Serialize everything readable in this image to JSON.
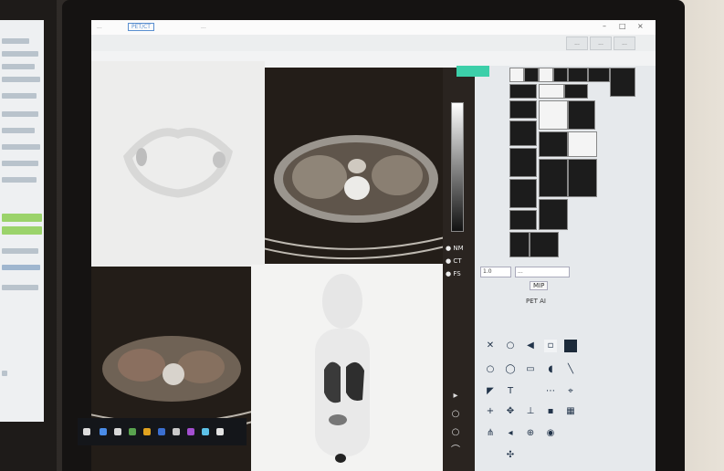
{
  "window": {
    "title_left": "...",
    "title_right": "...",
    "tab1": "PET/CT"
  },
  "toolbar": {
    "btn_a": "...",
    "btn_b": "...",
    "btn_c": "..."
  },
  "palette": {
    "radio_nm": "NM",
    "radio_ct": "CT",
    "radio_fs": "FS",
    "field_a": "1.0",
    "label_mode": "MIP",
    "label_pet": "PET AI",
    "field_b": "..."
  },
  "colors": {
    "accent": "#3ccfa9",
    "screen_bg": "#f2f3f4",
    "ct_bg": "#231d18"
  },
  "icons": [
    "arrow-icon",
    "crosshair-icon",
    "text-tool-icon",
    "circle-tool-icon",
    "ruler-icon",
    "angle-icon",
    "rect-roi-icon",
    "ellipse-roi-icon",
    "pan-icon",
    "zoom-icon",
    "move-icon"
  ]
}
